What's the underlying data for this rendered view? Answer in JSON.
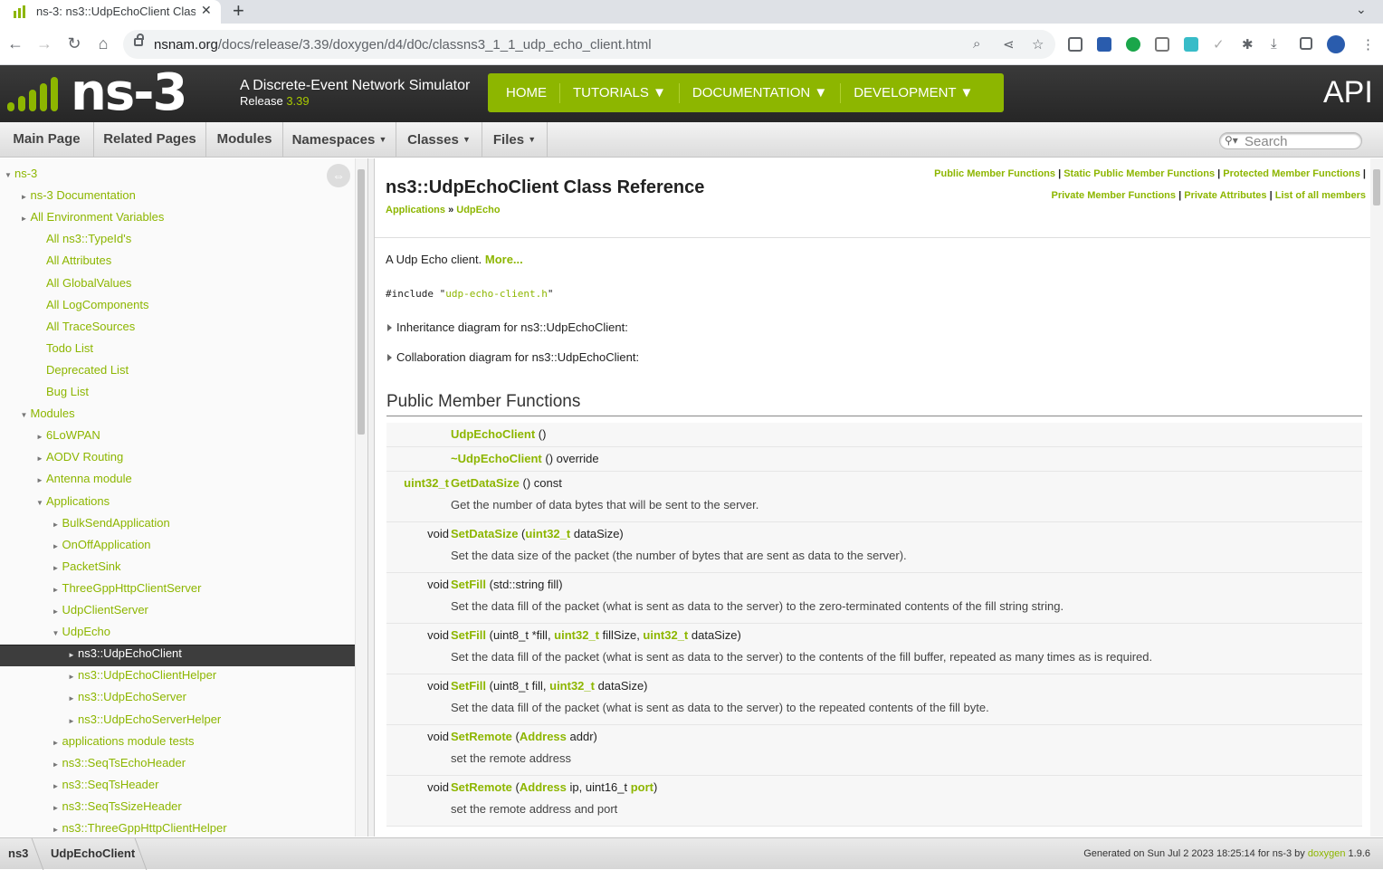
{
  "browser": {
    "tab_title": "ns-3: ns3::UdpEchoClient Clas",
    "tab_close": "✕",
    "new_tab": "+",
    "url_host": "nsnam.org",
    "url_path": "/docs/release/3.39/doxygen/d4/d0c/classns3_1_1_udp_echo_client.html"
  },
  "site": {
    "logo_text": "ns-3",
    "tagline": "A Discrete-Event Network Simulator",
    "release_label": "Release",
    "release_version": "3.39",
    "nav": [
      "HOME",
      "TUTORIALS  ▼",
      "DOCUMENTATION  ▼",
      "DEVELOPMENT  ▼"
    ],
    "api_label": "API",
    "accent": "#8db600"
  },
  "doxtabs": {
    "main_page": "Main Page",
    "related_pages": "Related Pages",
    "modules": "Modules",
    "namespaces": "Namespaces",
    "classes": "Classes",
    "files": "Files",
    "search_placeholder": "Search"
  },
  "sidebar": {
    "items": [
      {
        "label": "ns-3",
        "toggle": "▼"
      },
      {
        "label": "ns-3 Documentation",
        "toggle": "►"
      },
      {
        "label": "All Environment Variables",
        "toggle": "►"
      },
      {
        "label": "All ns3::TypeId's",
        "toggle": ""
      },
      {
        "label": "All Attributes",
        "toggle": ""
      },
      {
        "label": "All GlobalValues",
        "toggle": ""
      },
      {
        "label": "All LogComponents",
        "toggle": ""
      },
      {
        "label": "All TraceSources",
        "toggle": ""
      },
      {
        "label": "Todo List",
        "toggle": ""
      },
      {
        "label": "Deprecated List",
        "toggle": ""
      },
      {
        "label": "Bug List",
        "toggle": ""
      },
      {
        "label": "Modules",
        "toggle": "▼"
      },
      {
        "label": "6LoWPAN",
        "toggle": "►"
      },
      {
        "label": "AODV Routing",
        "toggle": "►"
      },
      {
        "label": "Antenna module",
        "toggle": "►"
      },
      {
        "label": "Applications",
        "toggle": "▼"
      },
      {
        "label": "BulkSendApplication",
        "toggle": "►"
      },
      {
        "label": "OnOffApplication",
        "toggle": "►"
      },
      {
        "label": "PacketSink",
        "toggle": "►"
      },
      {
        "label": "ThreeGppHttpClientServer",
        "toggle": "►"
      },
      {
        "label": "UdpClientServer",
        "toggle": "►"
      },
      {
        "label": "UdpEcho",
        "toggle": "▼"
      },
      {
        "label": "ns3::UdpEchoClient",
        "toggle": "►"
      },
      {
        "label": "ns3::UdpEchoClientHelper",
        "toggle": "►"
      },
      {
        "label": "ns3::UdpEchoServer",
        "toggle": "►"
      },
      {
        "label": "ns3::UdpEchoServerHelper",
        "toggle": "►"
      },
      {
        "label": "applications module tests",
        "toggle": "►"
      },
      {
        "label": "ns3::SeqTsEchoHeader",
        "toggle": "►"
      },
      {
        "label": "ns3::SeqTsHeader",
        "toggle": "►"
      },
      {
        "label": "ns3::SeqTsSizeHeader",
        "toggle": "►"
      },
      {
        "label": "ns3::ThreeGppHttpClientHelper",
        "toggle": "►"
      }
    ],
    "selected_item": "ns3::UdpEchoClient",
    "sync_icon": "⇔"
  },
  "content": {
    "summary_links": [
      "Public Member Functions",
      "Static Public Member Functions",
      "Protected Member Functions",
      "Private Member Functions",
      "Private Attributes",
      "List of all members"
    ],
    "separator": "|",
    "title": "ns3::UdpEchoClient Class Reference",
    "ingroup_1": "Applications",
    "ingroup_sep": "»",
    "ingroup_2": "UdpEcho",
    "brief": "A Udp Echo client.",
    "more": "More...",
    "include_prefix": "#include \"",
    "include_file": "udp-echo-client.h",
    "include_suffix": "\"",
    "inheritance": "Inheritance diagram for ns3::UdpEchoClient:",
    "collaboration": "Collaboration diagram for ns3::UdpEchoClient:",
    "section_title": "Public Member Functions",
    "members": [
      {
        "ret": "",
        "name": "UdpEchoClient",
        "sig": " ()",
        "desc": ""
      },
      {
        "ret": "",
        "name": "~UdpEchoClient",
        "sig": " () override",
        "desc": ""
      },
      {
        "ret": "uint32_t",
        "name": "GetDataSize",
        "sig": " () const",
        "desc": "Get the number of data bytes that will be sent to the server."
      },
      {
        "ret": "void",
        "name": "SetDataSize",
        "sig": "",
        "desc": "Set the data size of the packet (the number of bytes that are sent as data to the server)."
      },
      {
        "ret": "void",
        "name": "SetFill",
        "sig": " (std::string fill)",
        "desc": "Set the data fill of the packet (what is sent as data to the server) to the zero-terminated contents of the fill string string."
      },
      {
        "ret": "void",
        "name": "SetFill",
        "sig": "",
        "desc": "Set the data fill of the packet (what is sent as data to the server) to the contents of the fill buffer, repeated as many times as is required."
      },
      {
        "ret": "void",
        "name": "SetFill",
        "sig": "",
        "desc": "Set the data fill of the packet (what is sent as data to the server) to the repeated contents of the fill byte."
      },
      {
        "ret": "void",
        "name": "SetRemote",
        "sig": "",
        "desc": "set the remote address"
      },
      {
        "ret": "void",
        "name": "SetRemote",
        "sig": "",
        "desc": "set the remote address and port"
      }
    ],
    "sig_parts": {
      "open": " (",
      "close": ")",
      "uint32": "uint32_t",
      "datasize": " dataSize",
      "fillptr": "uint8_t *fill, ",
      "fillsize": " fillSize, ",
      "fillbyte": "uint8_t fill, ",
      "address": "Address",
      "addr": " addr",
      "ip": " ip, uint16_t ",
      "port": "port"
    }
  },
  "footer": {
    "crumb_1": "ns3",
    "crumb_2": "UdpEchoClient",
    "generated": "Generated on Sun Jul 2 2023 18:25:14 for ns-3 by",
    "doxygen_alt": "doxygen",
    "version": "1.9.6"
  }
}
